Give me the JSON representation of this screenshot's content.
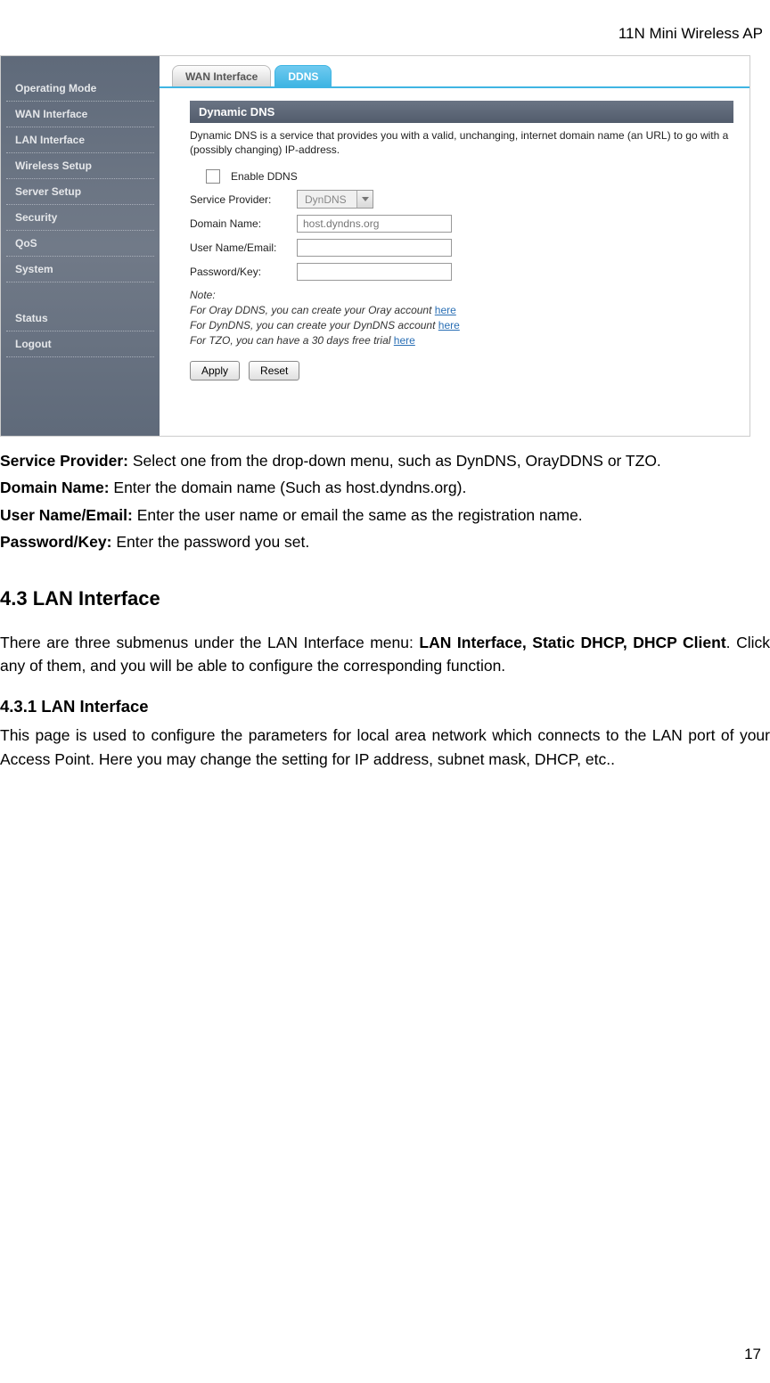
{
  "doc": {
    "header": "11N Mini Wireless AP",
    "page_number": "17",
    "defs": [
      {
        "term": "Service Provider:",
        "text": " Select one from the drop-down menu, such as DynDNS, OrayDDNS or TZO."
      },
      {
        "term": "Domain Name:",
        "text": " Enter the domain name (Such as host.dyndns.org)."
      },
      {
        "term": "User Name/Email:",
        "text": " Enter the user name or email the same as the registration name."
      },
      {
        "term": "Password/Key:",
        "text": " Enter the password you set."
      }
    ],
    "section_43_title": "4.3 LAN Interface",
    "section_43_intro_a": "There are three submenus under the LAN Interface menu: ",
    "section_43_intro_b": "LAN Interface, Static DHCP, DHCP Client",
    "section_43_intro_c": ". Click any of them, and you will be able to configure the corresponding function.",
    "section_431_title": "4.3.1 LAN Interface",
    "section_431_text": "This page is used to configure the parameters for local area network which connects to the LAN port of your Access Point. Here you may change the setting for IP address, subnet mask, DHCP, etc.."
  },
  "ui": {
    "sidebar": [
      "Operating Mode",
      "WAN Interface",
      "LAN Interface",
      "Wireless Setup",
      "Server Setup",
      "Security",
      "QoS",
      "System"
    ],
    "sidebar2": [
      "Status",
      "Logout"
    ],
    "tabs": {
      "wan": "WAN Interface",
      "ddns": "DDNS"
    },
    "panel": {
      "title": "Dynamic DNS",
      "desc": "Dynamic DNS is a service that provides you with a valid, unchanging, internet domain name (an URL) to go with a (possibly changing) IP-address.",
      "enable_label": "Enable DDNS",
      "sp_label": "Service Provider:",
      "sp_value": "DynDNS",
      "dn_label": "Domain Name:",
      "dn_placeholder": "host.dyndns.org",
      "un_label": "User Name/Email:",
      "pw_label": "Password/Key:",
      "note_lead": "Note:",
      "note1_a": "For Oray DDNS, you can create your Oray account ",
      "note1_b": "here",
      "note2_a": "For DynDNS, you can create your DynDNS account ",
      "note2_b": "here",
      "note3_a": "For TZO, you can have a 30 days free trial ",
      "note3_b": "here",
      "apply": "Apply",
      "reset": "Reset"
    }
  }
}
